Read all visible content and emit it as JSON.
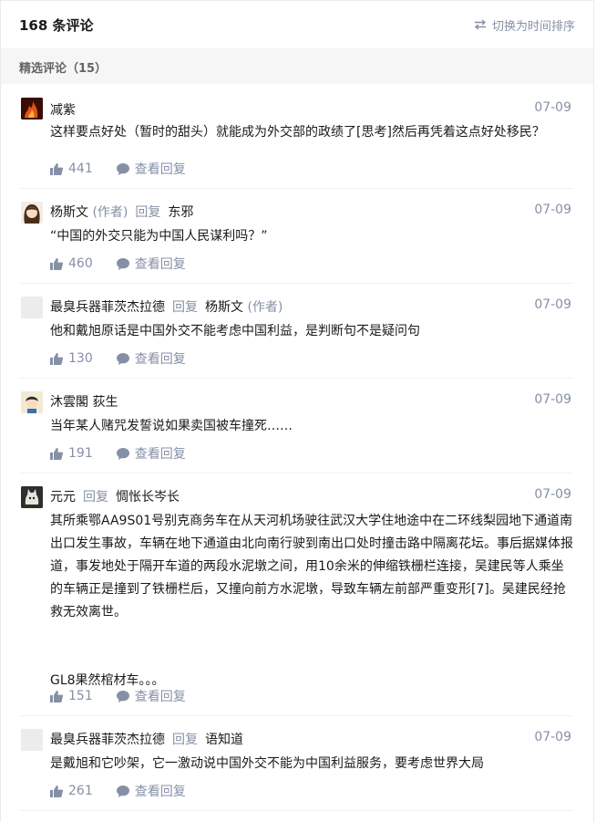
{
  "header": {
    "count_label": "168 条评论",
    "sort_label": "切换为时间排序"
  },
  "section": {
    "label": "精选评论（15）"
  },
  "comments": [
    {
      "author": "减紫",
      "reply_label": "",
      "reply_to": "",
      "date": "07-09",
      "text": "这样要点好处（暂时的甜头）就能成为外交部的政绩了[思考]然后再凭着这点好处移民？",
      "likes": "441",
      "view_replies": "查看回复",
      "avatar_icon": "fire-avatar-icon",
      "avatar_color": "#8b2a0c"
    },
    {
      "author": "杨斯文",
      "author_tag": "(作者)",
      "reply_label": "回复",
      "reply_to": "东邪",
      "date": "07-09",
      "text": "“中国的外交只能为中国人民谋利吗？”",
      "likes": "460",
      "view_replies": "查看回复",
      "avatar_icon": "cartoon-girl-avatar-icon",
      "avatar_color": "#5a3a22"
    },
    {
      "author": "最臭兵器菲茨杰拉德",
      "reply_label": "回复",
      "reply_to": "杨斯文",
      "reply_to_tag": "(作者)",
      "date": "07-09",
      "text": "他和戴旭原话是中国外交不能考虑中国利益，是判断句不是疑问句",
      "likes": "130",
      "view_replies": "查看回复",
      "avatar_icon": "blank-avatar-icon",
      "avatar_color": "#ececec"
    },
    {
      "author": "沐雲閣 荻生",
      "reply_label": "",
      "reply_to": "",
      "date": "07-09",
      "text": "当年某人赌咒发誓说如果卖国被车撞死……",
      "likes": "191",
      "view_replies": "查看回复",
      "avatar_icon": "cartoon-boy-avatar-icon",
      "avatar_color": "#d8c39a"
    },
    {
      "author": "元元",
      "reply_label": "回复",
      "reply_to": "惆怅长岑长",
      "date": "07-09",
      "text": "其所乘鄂AA9S01号别克商务车在从天河机场驶往武汉大学住地途中在二环线梨园地下通道南出口发生事故，车辆在地下通道由北向南行驶到南出口处时撞击路中隔离花坛。事后据媒体报道，事发地处于隔开车道的两段水泥墩之间，用10余米的伸缩铁栅栏连接，吴建民等人乘坐的车辆正是撞到了铁栅栏后，又撞向前方水泥墩，导致车辆左前部严重变形[7]。吴建民经抢救无效离世。\n\n\nGL8果然棺材车。。。",
      "likes": "151",
      "view_replies": "查看回复",
      "avatar_icon": "cat-photo-avatar-icon",
      "avatar_color": "#4a4a4a"
    },
    {
      "author": "最臭兵器菲茨杰拉德",
      "reply_label": "回复",
      "reply_to": "语知道",
      "date": "07-09",
      "text": "是戴旭和它吵架，它一激动说中国外交不能为中国利益服务，要考虑世界大局",
      "likes": "261",
      "view_replies": "查看回复",
      "avatar_icon": "blank-avatar-icon",
      "avatar_color": "#ececec"
    }
  ]
}
